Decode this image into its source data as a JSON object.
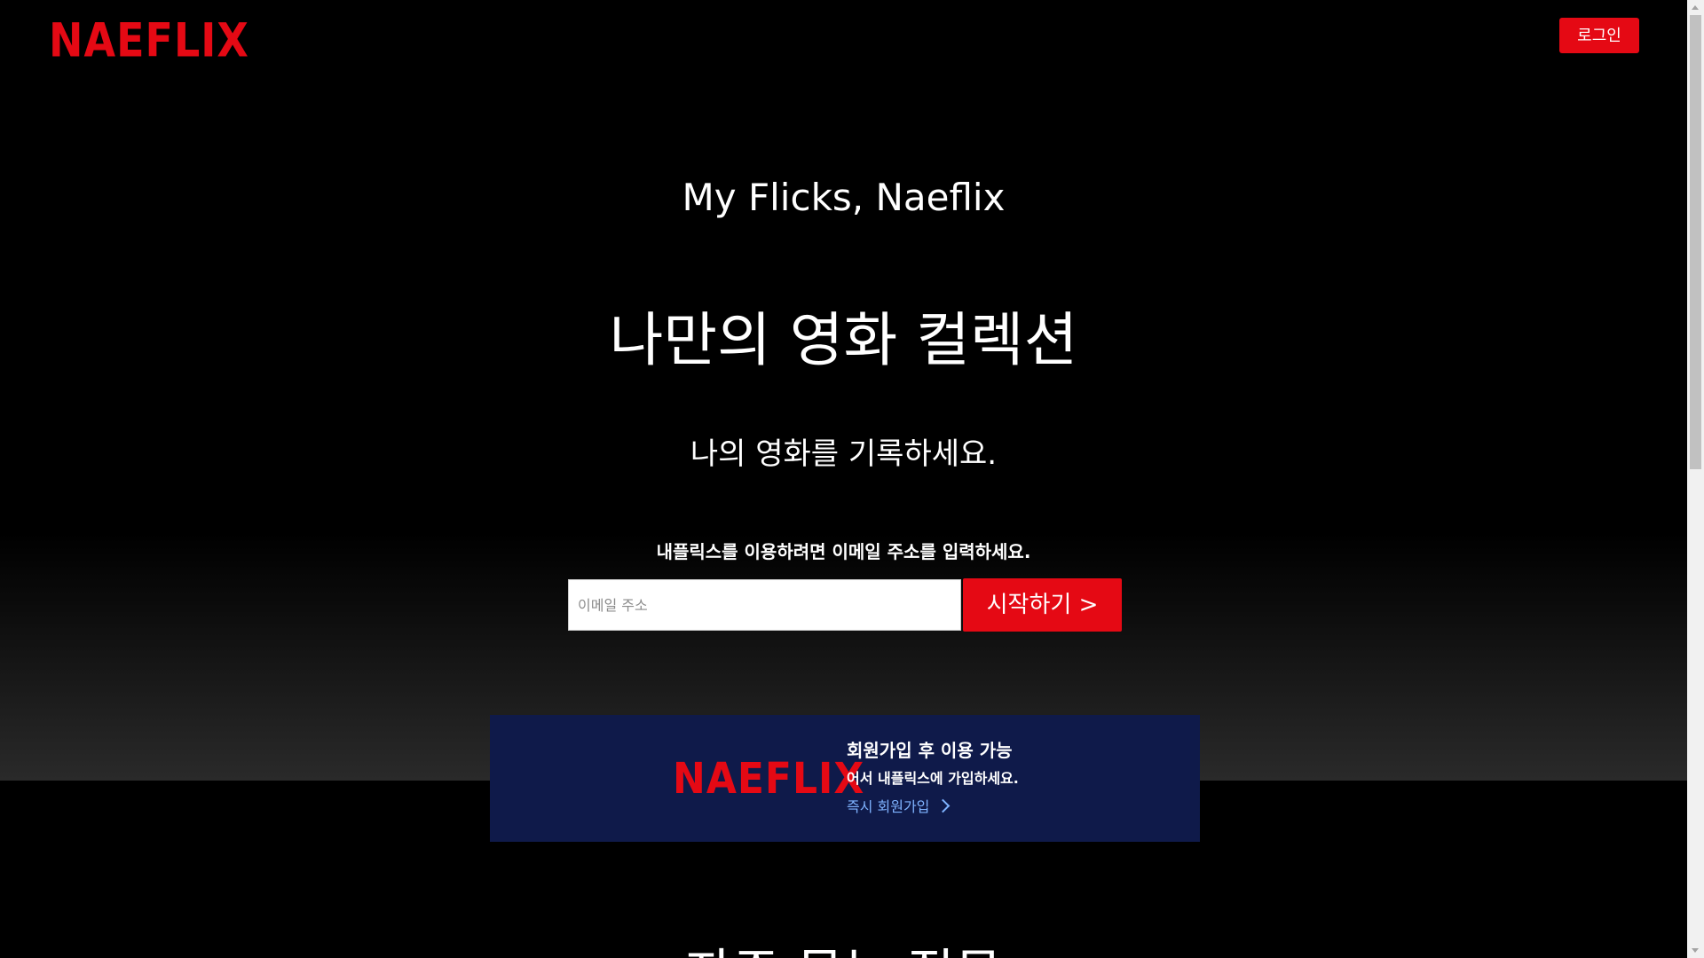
{
  "header": {
    "logo_text": "NAEFLIX",
    "login_label": "로그인"
  },
  "hero": {
    "tagline": "My Flicks, Naeflix",
    "headline": "나만의 영화 컬렉션",
    "subhead": "나의 영화를 기록하세요.",
    "prompt": "내플릭스를 이용하려면 이메일 주소를 입력하세요.",
    "email_placeholder": "이메일 주소",
    "email_value": "",
    "start_label": "시작하기 >"
  },
  "banner": {
    "logo_text": "NAEFLIX",
    "title": "회원가입 후 이용 가능",
    "description": "어서 내플릭스에 가입하세요.",
    "link_label": "즉시 회원가입"
  },
  "faq": {
    "title": "자주 묻는 질문"
  },
  "colors": {
    "brand_red": "#e50914",
    "banner_bg": "#0f1a4a",
    "link_blue": "#7fb3ff"
  }
}
